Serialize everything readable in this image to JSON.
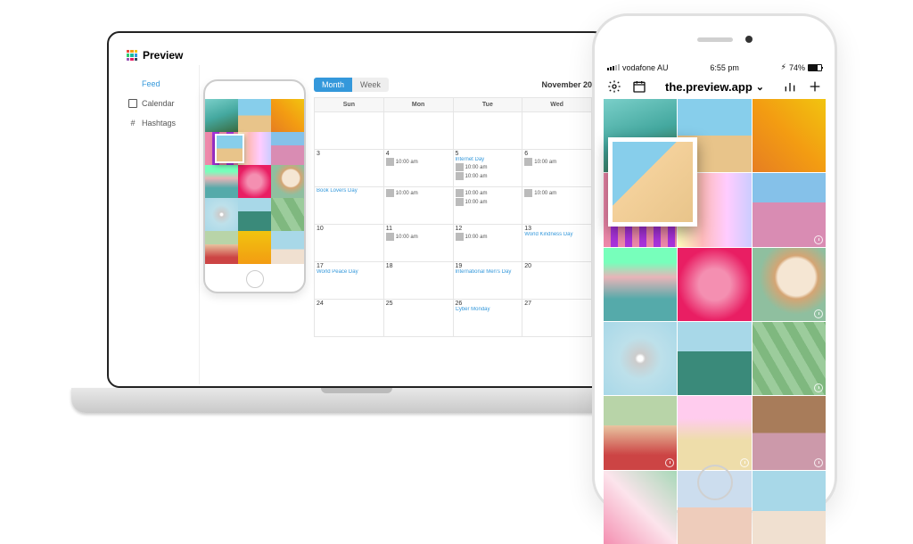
{
  "desktop": {
    "app_name": "Preview",
    "sidebar": {
      "items": [
        {
          "label": "Feed",
          "active": true,
          "icon": "grid"
        },
        {
          "label": "Calendar",
          "active": false,
          "icon": "calendar"
        },
        {
          "label": "Hashtags",
          "active": false,
          "icon": "hashtag"
        }
      ]
    },
    "calendar": {
      "view_month": "Month",
      "view_week": "Week",
      "active_view": "Month",
      "month_label": "November 20",
      "day_headers": [
        "Sun",
        "Mon",
        "Tue",
        "Wed"
      ],
      "weeks": [
        {
          "cells": [
            {
              "n": ""
            },
            {
              "n": ""
            },
            {
              "n": ""
            },
            {
              "n": ""
            }
          ]
        },
        {
          "cells": [
            {
              "n": "3"
            },
            {
              "n": "4",
              "t": "10:00 am"
            },
            {
              "n": "5",
              "link": "Internet Day",
              "t": "10:00 am",
              "t2": "10:00 am"
            },
            {
              "n": "6",
              "t": "10:00 am"
            }
          ]
        },
        {
          "cells": [
            {
              "n": "",
              "link": "Book Lovers Day"
            },
            {
              "n": "",
              "t": "10:00 am"
            },
            {
              "n": "",
              "t": "10:00 am",
              "t2": "10:00 am"
            },
            {
              "n": "",
              "t": "10:00 am"
            }
          ]
        },
        {
          "cells": [
            {
              "n": "10"
            },
            {
              "n": "11",
              "t": "10:00 am"
            },
            {
              "n": "12",
              "t": "10:00 am"
            },
            {
              "n": "13",
              "link": "World Kindness Day"
            }
          ]
        },
        {
          "cells": [
            {
              "n": "17",
              "link": "World Peace Day"
            },
            {
              "n": "18"
            },
            {
              "n": "19",
              "link": "International Men's Day"
            },
            {
              "n": "20"
            }
          ]
        },
        {
          "cells": [
            {
              "n": "24"
            },
            {
              "n": "25"
            },
            {
              "n": "26",
              "link": "Cyber Monday"
            },
            {
              "n": "27"
            }
          ]
        }
      ]
    }
  },
  "phone": {
    "status": {
      "carrier": "vodafone AU",
      "time": "6:55 pm",
      "battery": "74%",
      "bolt": "⚡︎"
    },
    "toolbar": {
      "title": "the.preview.app"
    }
  }
}
